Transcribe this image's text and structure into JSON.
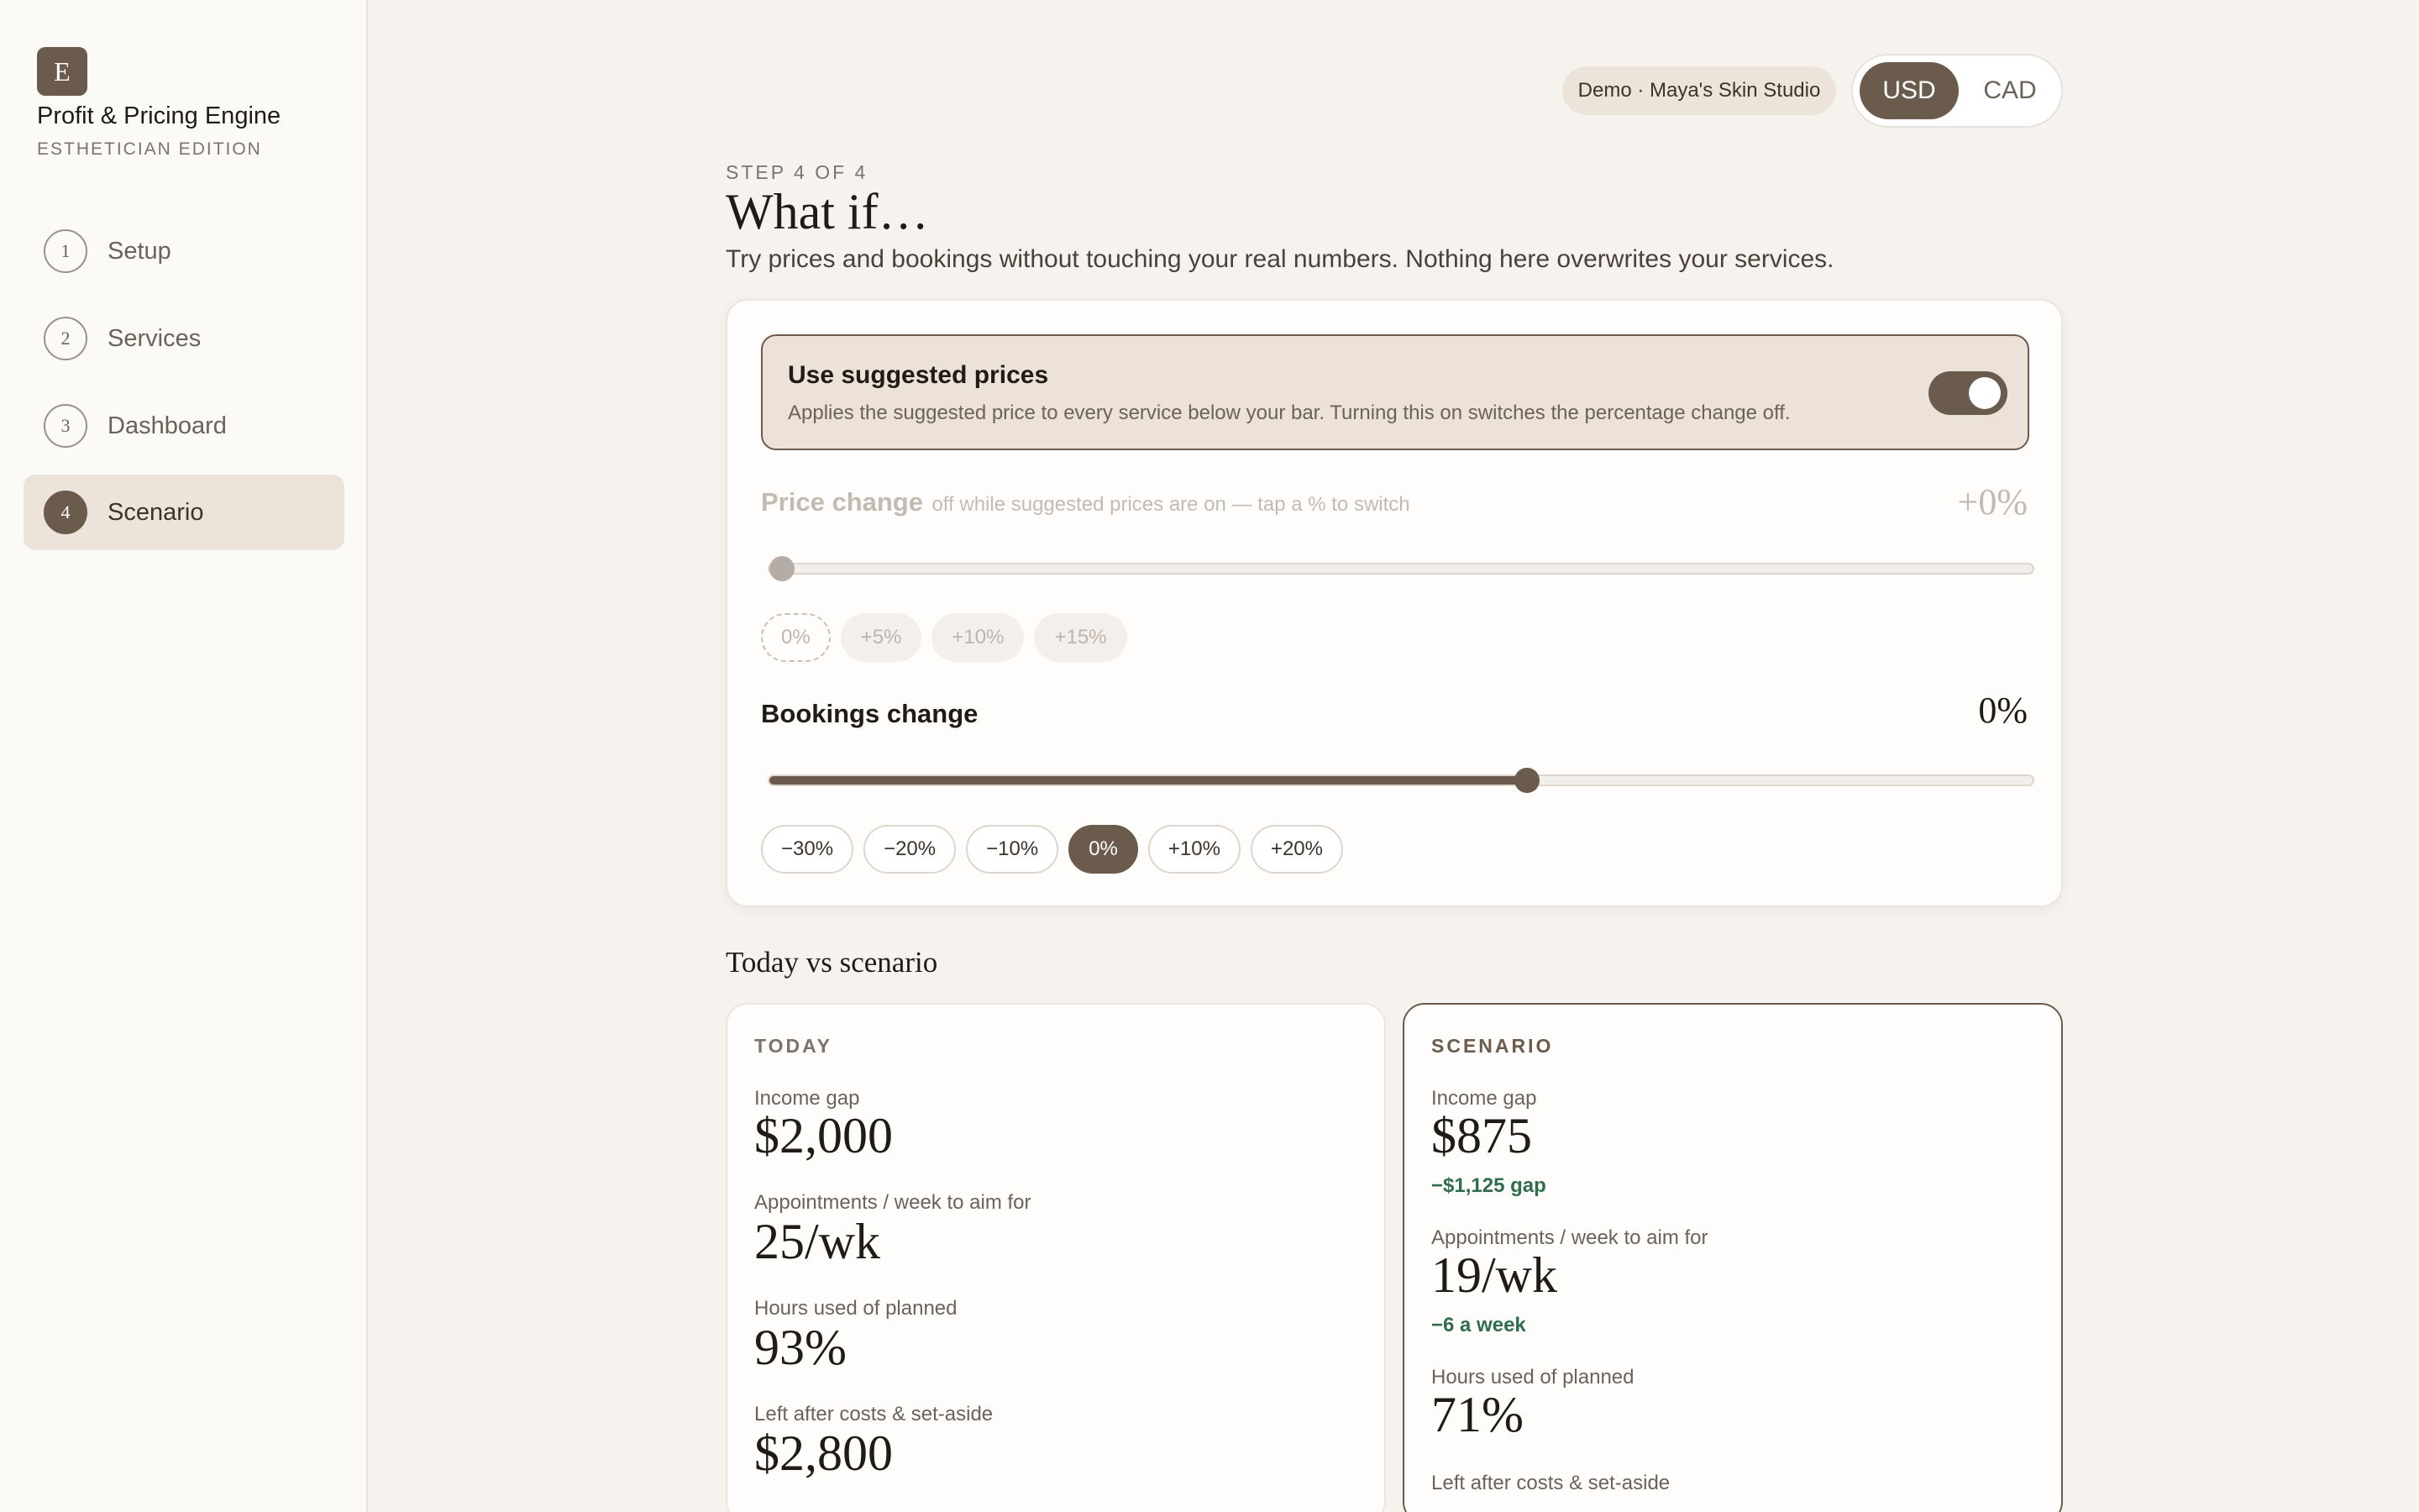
{
  "app": {
    "logo_letter": "E",
    "title": "Profit & Pricing Engine",
    "subtitle": "ESTHETICIAN EDITION"
  },
  "nav": [
    {
      "num": "1",
      "label": "Setup",
      "active": false
    },
    {
      "num": "2",
      "label": "Services",
      "active": false
    },
    {
      "num": "3",
      "label": "Dashboard",
      "active": false
    },
    {
      "num": "4",
      "label": "Scenario",
      "active": true
    }
  ],
  "topbar": {
    "demo_label": "Demo · Maya's Skin Studio",
    "currency_options": [
      "USD",
      "CAD"
    ],
    "currency_selected": "USD"
  },
  "header": {
    "step": "STEP 4 OF 4",
    "title": "What if…",
    "description": "Try prices and bookings without touching your real numbers. Nothing here overwrites your services."
  },
  "suggested": {
    "title": "Use suggested prices",
    "description": "Applies the suggested price to every service below your bar. Turning this on switches the percentage change off.",
    "enabled": true
  },
  "price_change": {
    "label": "Price change",
    "hint": "off while suggested prices are on — tap a % to switch",
    "value": "+0%",
    "slider_fraction": 0,
    "chips": [
      "0%",
      "+5%",
      "+10%",
      "+15%"
    ],
    "selected": "0%"
  },
  "bookings_change": {
    "label": "Bookings change",
    "value": "0%",
    "slider_fraction": 0.6,
    "chips": [
      "−30%",
      "−20%",
      "−10%",
      "0%",
      "+10%",
      "+20%"
    ],
    "selected": "0%"
  },
  "comparison": {
    "title": "Today vs scenario",
    "today": {
      "heading": "TODAY",
      "income_gap_label": "Income gap",
      "income_gap": "$2,000",
      "appts_label": "Appointments / week to aim for",
      "appts": "25/wk",
      "hours_label": "Hours used of planned",
      "hours": "93%",
      "left_label": "Left after costs & set-aside",
      "left": "$2,800"
    },
    "scenario": {
      "heading": "SCENARIO",
      "income_gap_label": "Income gap",
      "income_gap": "$875",
      "income_gap_delta": "−$1,125 gap",
      "appts_label": "Appointments / week to aim for",
      "appts": "19/wk",
      "appts_delta": "−6 a week",
      "hours_label": "Hours used of planned",
      "hours": "71%",
      "left_label": "Left after costs & set-aside"
    }
  },
  "colors": {
    "accent": "#6b5b4d",
    "positive": "#2f6e4b",
    "background": "#f6f3ef"
  }
}
